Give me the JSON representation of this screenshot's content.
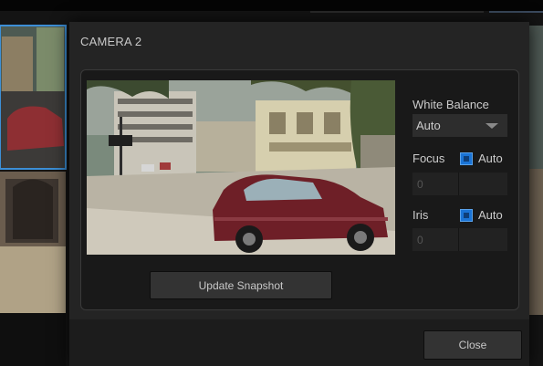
{
  "dialog": {
    "title": "CAMERA 2",
    "update_snapshot_label": "Update Snapshot",
    "close_label": "Close"
  },
  "controls": {
    "white_balance": {
      "label": "White Balance",
      "value": "Auto"
    },
    "focus": {
      "label": "Focus",
      "auto_label": "Auto",
      "auto_checked": true,
      "value": "0"
    },
    "iris": {
      "label": "Iris",
      "auto_label": "Auto",
      "auto_checked": true,
      "value": "0"
    }
  },
  "colors": {
    "accent_blue": "#1a74d6",
    "dialog_bg": "#242424",
    "panel_bg": "#191919"
  },
  "icons": {
    "dropdown": "caret-down-icon",
    "checkbox": "checkbox-checked-icon"
  }
}
